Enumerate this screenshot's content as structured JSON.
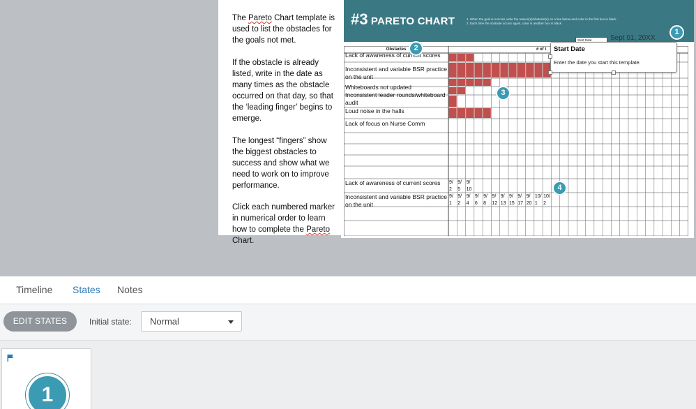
{
  "slide": {
    "paragraphs": [
      {
        "pre": "The ",
        "squiggle": "Pareto",
        "post": " Chart template is used to list the obstacles for the goals not met."
      },
      {
        "pre": "If the obstacle is already listed, write in the date as many times as the obstacle occurred on that day, so that the ‘leading finger’ begins to emerge.",
        "squiggle": "",
        "post": ""
      },
      {
        "pre": "The longest “fingers” show the biggest obstacles to success and show what we need to work on to improve performance.",
        "squiggle": "",
        "post": ""
      },
      {
        "pre": "Click each numbered marker in numerical order to learn how to complete the ",
        "squiggle": "Pareto",
        "post": " Chart."
      }
    ],
    "chart_header": {
      "number": "#3",
      "title": "PARETO CHART",
      "note_1": "1. When the goal is not met, write the reason(s)/obstacle(s) on a line below and color in the first box in black",
      "note_2": "2. Each time the obstacle occurs again, color in another box in black"
    },
    "start_date_label": "Start Date:",
    "start_date_value": "Sept 01, 20XX",
    "obstacles_header": "Obstacles",
    "count_header": "# of t",
    "obstacles": [
      {
        "label": "Lack of awareness of current scores",
        "count": 3
      },
      {
        "label": "Inconsistent and variable BSR practice on the unit",
        "count": 12
      },
      {
        "label": "Whiteboards not updated",
        "count": 5
      },
      {
        "label": "Inconsistent leader rounds/whiteboard audit",
        "count": 2
      },
      {
        "label": "Loud noise in the halls",
        "count": 1
      },
      {
        "label": "Lack of focus on Nurse Comm",
        "count": 5
      }
    ],
    "example_rows": [
      {
        "label": "Lack of awareness of current scores",
        "dates": [
          "9/2",
          "9/5",
          "9/10"
        ]
      },
      {
        "label": "Inconsistent and variable BSR practice on the unit",
        "dates": [
          "9/1",
          "9/2",
          "9/4",
          "9/6",
          "9/8",
          "9/12",
          "9/13",
          "9/15",
          "9/17",
          "9/20",
          "10/1",
          "10/2"
        ]
      }
    ],
    "bar_color": "#c0504d",
    "header_color": "#3a7884",
    "markers": [
      "1",
      "2",
      "3",
      "4"
    ],
    "callout": {
      "title": "Start Date",
      "body": "Enter the date you start this template."
    }
  },
  "tabs": [
    "Timeline",
    "States",
    "Notes"
  ],
  "active_tab": "States",
  "toolbar": {
    "edit_states_label": "EDIT STATES",
    "initial_state_label": "Initial state:",
    "initial_state_value": "Normal"
  },
  "states": [
    {
      "marker": "1"
    }
  ]
}
